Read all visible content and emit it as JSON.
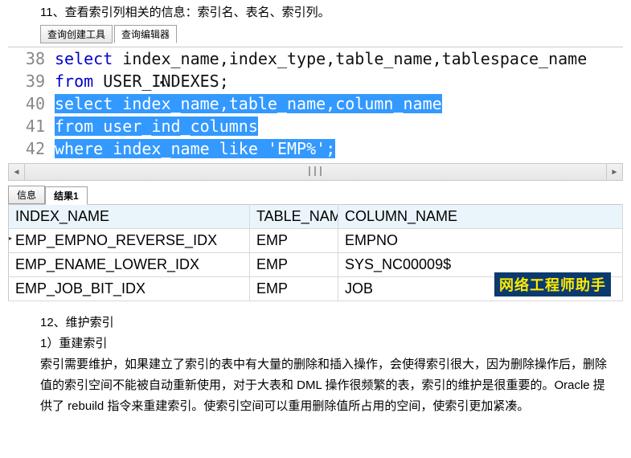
{
  "title11": "11、查看索引列相关的信息：索引名、表名、索引列。",
  "tabs": {
    "builder": "查询创建工具",
    "editor": "查询编辑器"
  },
  "lines": {
    "n38": "38",
    "n39": "39",
    "n40": "40",
    "n41": "41",
    "n42": "42",
    "l38_kw": "select",
    "l38_rest": " index_name,index_type,table_name,tablespace_name",
    "l39_kw": "from",
    "l39_rest": " USER_INDEXES;",
    "l40_kw": "select",
    "l40_rest": " index_name,table_name,column_name",
    "l41_kw": "from",
    "l41_rest": " user_ind_columns",
    "l42_kw": "where",
    "l42_mid": " index_name ",
    "l42_like": "like",
    "l42_sp": " ",
    "l42_str": "'EMP%'",
    "l42_end": ";"
  },
  "resultTabs": {
    "info": "信息",
    "r1": "结果1"
  },
  "grid": {
    "h1": "INDEX_NAME",
    "h2": "TABLE_NAME",
    "h3": "COLUMN_NAME",
    "r1c1": "EMP_EMPNO_REVERSE_IDX",
    "r1c2": "EMP",
    "r1c3": "EMPNO",
    "r2c1": "EMP_ENAME_LOWER_IDX",
    "r2c2": "EMP",
    "r2c3": "SYS_NC00009$",
    "r3c1": "EMP_JOB_BIT_IDX",
    "r3c2": "EMP",
    "r3c3": "JOB"
  },
  "watermark": "网络工程师助手",
  "para": {
    "t12": "12、维护索引",
    "t12a": "1）重建索引",
    "body": "索引需要维护，如果建立了索引的表中有大量的删除和插入操作，会使得索引很大，因为删除操作后，删除值的索引空间不能被自动重新使用，对于大表和 DML 操作很频繁的表，索引的维护是很重要的。Oracle 提供了 rebuild 指令来重建索引。使索引空间可以重用删除值所占用的空间，使索引更加紧凑。"
  }
}
